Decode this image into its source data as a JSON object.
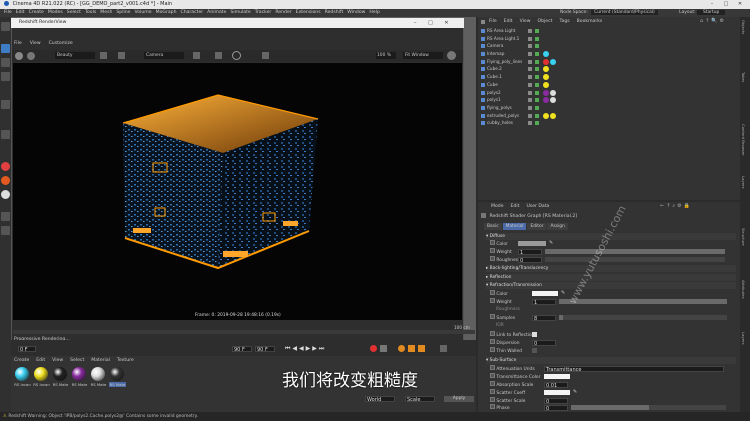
{
  "window": {
    "title": "Cinema 4D R21.022 (RC) - [GG_DEMO_part2_v001.c4d *] - Main",
    "controls": [
      "–",
      "□",
      "✕"
    ]
  },
  "menubar": [
    "File",
    "Edit",
    "Create",
    "Modes",
    "Select",
    "Tools",
    "Mesh",
    "Spline",
    "Volume",
    "MoGraph",
    "Character",
    "Animate",
    "Simulate",
    "Tracker",
    "Render",
    "Extensions",
    "Redshift",
    "Window",
    "Help"
  ],
  "nodespace": {
    "label": "Node Space:",
    "value": "Current (Standard/Physical)",
    "layout_label": "Layout:",
    "layout_value": "Startup"
  },
  "renderview": {
    "title": "Redshift RenderView",
    "menu": [
      "File",
      "View",
      "Customize"
    ],
    "quality": "Beauty",
    "camera": "Camera",
    "zoom": "100 %",
    "fit": "Fit Window",
    "frame_info": "Frame: 0:  2019-09-28  19:48:16  (0.19s)",
    "status": "Progressive Rendering...",
    "scale": "100 cm"
  },
  "object_manager": {
    "menu": [
      "File",
      "Edit",
      "View",
      "Object",
      "Tags",
      "Bookmarks"
    ],
    "objects": [
      "RS Area Light",
      "RS Area Light.1",
      "Camera",
      "Intemap",
      "Flying_poly_lines",
      "Cube.2",
      "Cube.1",
      "Cube",
      "polys2",
      "polys1",
      "flying_polys",
      "extruded_polys",
      "cubby_holes"
    ]
  },
  "attributes": {
    "menu": [
      "Mode",
      "Edit",
      "User Data"
    ],
    "header": "Redshift Shader Graph [RS Material.2]",
    "tabs": [
      "Basic",
      "Material",
      "Editor",
      "Assign"
    ],
    "active_tab": "Material",
    "diffuse": {
      "title": "Diffuse",
      "color": "Color",
      "weight": "Weight",
      "weight_value": "1",
      "roughness": "Roughness",
      "roughness_value": "0"
    },
    "backlight": "Back-lighting/Translucency",
    "reflection": "Reflection",
    "refraction": {
      "title": "Refraction/Transmission",
      "color": "Color",
      "weight": "Weight",
      "weight_value": "1",
      "roughness": "Roughness",
      "samples": "Samples",
      "samples_value": "8",
      "ior": "IOR",
      "link": "Link to Reflection",
      "dispersion": "Dispersion",
      "dispersion_value": "0",
      "thin": "Thin Walled"
    },
    "subsurface": {
      "title": "Sub-Surface",
      "atten": "Attenuation Units",
      "atten_value": "Transmittance",
      "trans_color": "Transmittance Color",
      "abs_scale": "Absorption Scale",
      "abs_value": "0.01",
      "scatter_coeff": "Scatter Coeff",
      "scatter_scale": "Scatter Scale",
      "scatter_value": "0",
      "phase": "Phase",
      "phase_value": "0",
      "samples": "Samples",
      "samples_value": "16"
    }
  },
  "timeline": {
    "start": "0 F",
    "cur": "90 F",
    "end": "90 F",
    "frame": "0"
  },
  "material_manager": {
    "menu": [
      "Create",
      "Edit",
      "View",
      "Select",
      "Material",
      "Texture"
    ],
    "materials": [
      {
        "name": "RS Incan",
        "color": "#3ad0f0"
      },
      {
        "name": "RS Incan",
        "color": "#f0e020"
      },
      {
        "name": "RS Mate",
        "color": "#222222"
      },
      {
        "name": "RS Mate",
        "color": "#8a2ca0"
      },
      {
        "name": "RS Mate",
        "color": "#dddddd"
      },
      {
        "name": "RS Mate",
        "color": "#333333"
      }
    ]
  },
  "subtitle": "我们将改变粗糙度",
  "watermark": "www.yutusoshi.com",
  "statusbar": "Redshift Warning: Object 'IPB/polys2.Cache.polys2@' Contains some invalid geometry.",
  "bottom_fields": {
    "world": "World",
    "scale": "Scale",
    "apply": "Apply"
  },
  "side_tabs": [
    "Objects",
    "Takes",
    "Content Browser",
    "Layers",
    "Structure",
    "Attributes",
    "Layers"
  ],
  "accent": "#ff9a00"
}
